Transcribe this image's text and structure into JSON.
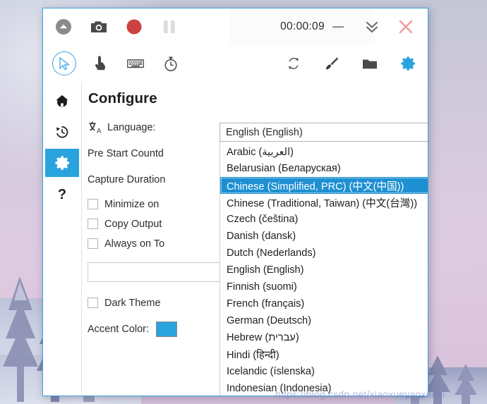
{
  "window": {
    "accent_color": "#29a3dd",
    "border_color": "#3aa3dd"
  },
  "title_bar": {
    "timer": "00:00:09",
    "left_buttons": [
      {
        "name": "collapse-up-button",
        "icon": "chevron-up-circle-icon",
        "label": "Collapse"
      },
      {
        "name": "screenshot-button",
        "icon": "camera-icon",
        "label": "Screenshot"
      },
      {
        "name": "record-button",
        "icon": "record-dot-icon",
        "label": "Record"
      },
      {
        "name": "pause-button",
        "icon": "pause-icon",
        "label": "Pause"
      }
    ],
    "right_buttons": [
      {
        "name": "minimize-button",
        "icon": "minimize-icon",
        "label": "Minimize"
      },
      {
        "name": "collapse-button",
        "icon": "double-chevron-down-icon",
        "label": "Collapse to tray"
      },
      {
        "name": "close-button",
        "icon": "close-x-icon",
        "label": "Close"
      }
    ]
  },
  "tool_bar": {
    "left_tools": [
      {
        "name": "cursor-tool",
        "icon": "cursor-arrow-icon",
        "label": "Cursor",
        "selected": true
      },
      {
        "name": "click-tool",
        "icon": "hand-pointer-icon",
        "label": "Clicks",
        "selected": false
      },
      {
        "name": "keystroke-tool",
        "icon": "keyboard-icon",
        "label": "Keystrokes",
        "selected": false
      },
      {
        "name": "timer-tool",
        "icon": "stopwatch-icon",
        "label": "Timer",
        "selected": false
      }
    ],
    "right_tools": [
      {
        "name": "refresh-tool",
        "icon": "refresh-icon",
        "label": "Refresh"
      },
      {
        "name": "brush-tool",
        "icon": "paintbrush-icon",
        "label": "Brush"
      },
      {
        "name": "folder-tool",
        "icon": "folder-icon",
        "label": "Open folder"
      },
      {
        "name": "settings-tool",
        "icon": "gear-icon",
        "label": "Settings"
      }
    ]
  },
  "sidebar": {
    "items": [
      {
        "name": "sidebar-item-home",
        "icon": "home-icon",
        "label": "Home",
        "active": false
      },
      {
        "name": "sidebar-item-recent",
        "icon": "history-clock-icon",
        "label": "Recent",
        "active": false
      },
      {
        "name": "sidebar-item-configure",
        "icon": "gear-icon",
        "label": "Configure",
        "active": true
      },
      {
        "name": "sidebar-item-help",
        "icon": "question-mark-icon",
        "label": "Help",
        "active": false
      }
    ]
  },
  "configure": {
    "title": "Configure",
    "language_label": "Language:",
    "language_icon": "translate-icon",
    "pre_start_countdown_label": "Pre Start Countd",
    "capture_duration_label": "Capture Duration",
    "checkboxes": [
      {
        "name": "checkbox-minimize-on",
        "label": "Minimize on",
        "checked": false
      },
      {
        "name": "checkbox-copy-output",
        "label": "Copy Output",
        "checked": false
      },
      {
        "name": "checkbox-always-on-top",
        "label": "Always on To",
        "checked": false
      }
    ],
    "text_inputs": [
      {
        "name": "config-text-field-1",
        "value": "",
        "placeholder": ""
      },
      {
        "name": "config-text-field-2",
        "value": "",
        "placeholder": ""
      }
    ],
    "dark_theme": {
      "name": "checkbox-dark-theme",
      "label": "Dark Theme",
      "checked": false
    },
    "accent_color_label": "Accent Color:",
    "accent_color_value": "#29a3dd"
  },
  "language_combo": {
    "selected_value": "English (English)",
    "arrow_icon": "chevron-down-icon",
    "highlighted_index": 2,
    "options": [
      "Arabic (العربية)",
      "Belarusian (Беларуская)",
      "Chinese (Simplified, PRC) (中文(中国))",
      "Chinese (Traditional, Taiwan) (中文(台灣))",
      "Czech (čeština)",
      "Danish (dansk)",
      "Dutch (Nederlands)",
      "English (English)",
      "Finnish (suomi)",
      "French (français)",
      "German (Deutsch)",
      "Hebrew (עברית)",
      "Hindi (हिन्दी)",
      "Icelandic (íslenska)",
      "Indonesian (Indonesia)"
    ],
    "scrollbar": {
      "up_icon": "scroll-up-arrow-icon",
      "down_icon": "scroll-down-arrow-icon",
      "thumb_name": "scrollbar-thumb"
    }
  },
  "watermark": "https://blog.csdn.net/xiaoxueyaoxuexi"
}
